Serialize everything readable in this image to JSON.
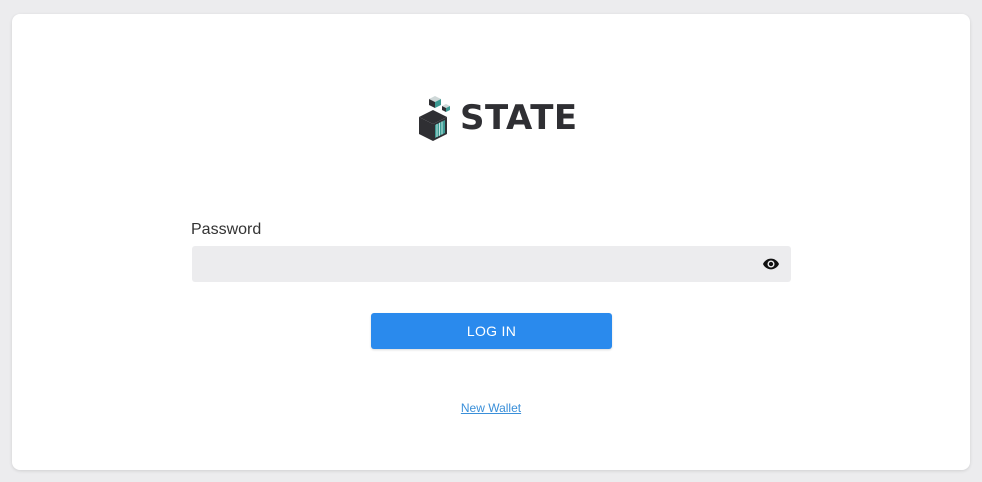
{
  "brand": {
    "name": "STATE",
    "logo_icon": "cube-logo-icon",
    "text_color": "#2f2f33",
    "accent_color": "#3d9a93"
  },
  "login_form": {
    "password_label": "Password",
    "password_value": "",
    "password_placeholder": "",
    "visibility_icon": "eye-icon",
    "login_label": "LOG IN",
    "login_color": "#2a8aed"
  },
  "footer": {
    "new_wallet_label": "New Wallet",
    "link_color": "#3a8fd9"
  }
}
